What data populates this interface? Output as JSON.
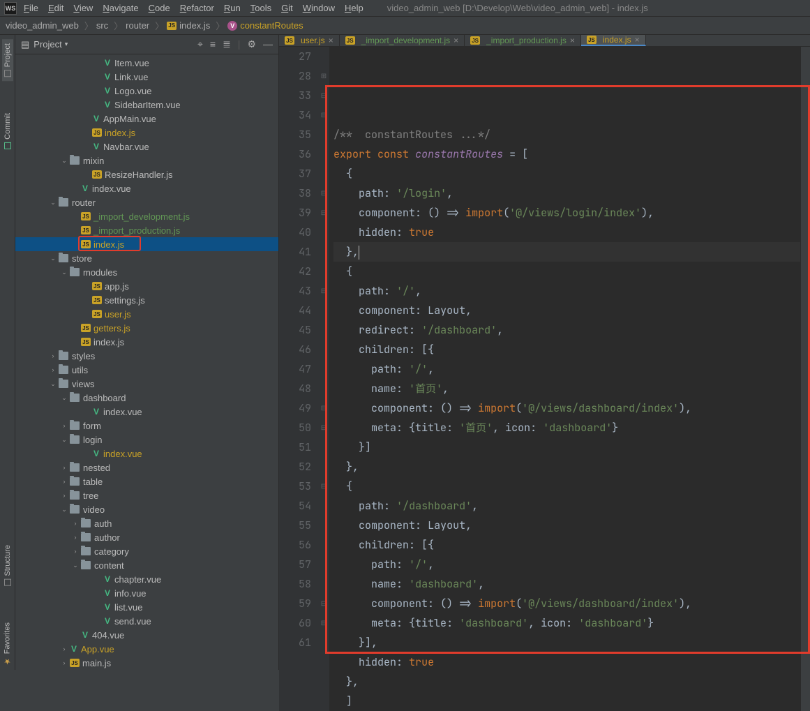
{
  "window_title": "video_admin_web [D:\\Develop\\Web\\video_admin_web] - index.js",
  "menus": [
    "File",
    "Edit",
    "View",
    "Navigate",
    "Code",
    "Refactor",
    "Run",
    "Tools",
    "Git",
    "Window",
    "Help"
  ],
  "breadcrumbs": [
    {
      "label": "video_admin_web",
      "type": "root"
    },
    {
      "label": "src",
      "type": "folder"
    },
    {
      "label": "router",
      "type": "folder"
    },
    {
      "label": "index.js",
      "type": "js"
    },
    {
      "label": "constantRoutes",
      "type": "var"
    }
  ],
  "project_panel_title": "Project",
  "side_tabs": [
    "Project",
    "Commit",
    "Structure",
    "Favorites"
  ],
  "tree": [
    {
      "indent": 7,
      "icon": "vue",
      "label": "Item.vue",
      "cls": ""
    },
    {
      "indent": 7,
      "icon": "vue",
      "label": "Link.vue",
      "cls": ""
    },
    {
      "indent": 7,
      "icon": "vue",
      "label": "Logo.vue",
      "cls": ""
    },
    {
      "indent": 7,
      "icon": "vue",
      "label": "SidebarItem.vue",
      "cls": ""
    },
    {
      "indent": 6,
      "icon": "vue",
      "label": "AppMain.vue",
      "cls": ""
    },
    {
      "indent": 6,
      "icon": "js",
      "label": "index.js",
      "cls": "yellow"
    },
    {
      "indent": 6,
      "icon": "vue",
      "label": "Navbar.vue",
      "cls": ""
    },
    {
      "indent": 4,
      "exp": "v",
      "icon": "folder",
      "label": "mixin",
      "cls": ""
    },
    {
      "indent": 6,
      "icon": "js",
      "label": "ResizeHandler.js",
      "cls": ""
    },
    {
      "indent": 5,
      "icon": "vue",
      "label": "index.vue",
      "cls": ""
    },
    {
      "indent": 3,
      "exp": "v",
      "icon": "folder",
      "label": "router",
      "cls": ""
    },
    {
      "indent": 5,
      "icon": "js",
      "label": "_import_development.js",
      "cls": "green"
    },
    {
      "indent": 5,
      "icon": "js",
      "label": "_import_production.js",
      "cls": "green"
    },
    {
      "indent": 5,
      "icon": "js",
      "label": "index.js",
      "cls": "yellow",
      "sel": true
    },
    {
      "indent": 3,
      "exp": "v",
      "icon": "folder",
      "label": "store",
      "cls": ""
    },
    {
      "indent": 4,
      "exp": "v",
      "icon": "folder",
      "label": "modules",
      "cls": ""
    },
    {
      "indent": 6,
      "icon": "js",
      "label": "app.js",
      "cls": ""
    },
    {
      "indent": 6,
      "icon": "js",
      "label": "settings.js",
      "cls": ""
    },
    {
      "indent": 6,
      "icon": "js",
      "label": "user.js",
      "cls": "yellow"
    },
    {
      "indent": 5,
      "icon": "js",
      "label": "getters.js",
      "cls": "yellow"
    },
    {
      "indent": 5,
      "icon": "js",
      "label": "index.js",
      "cls": ""
    },
    {
      "indent": 3,
      "exp": ">",
      "icon": "folder",
      "label": "styles",
      "cls": ""
    },
    {
      "indent": 3,
      "exp": ">",
      "icon": "folder",
      "label": "utils",
      "cls": ""
    },
    {
      "indent": 3,
      "exp": "v",
      "icon": "folder",
      "label": "views",
      "cls": ""
    },
    {
      "indent": 4,
      "exp": "v",
      "icon": "folder",
      "label": "dashboard",
      "cls": ""
    },
    {
      "indent": 6,
      "icon": "vue",
      "label": "index.vue",
      "cls": ""
    },
    {
      "indent": 4,
      "exp": ">",
      "icon": "folder",
      "label": "form",
      "cls": ""
    },
    {
      "indent": 4,
      "exp": "v",
      "icon": "folder",
      "label": "login",
      "cls": ""
    },
    {
      "indent": 6,
      "icon": "vue",
      "label": "index.vue",
      "cls": "yellow"
    },
    {
      "indent": 4,
      "exp": ">",
      "icon": "folder",
      "label": "nested",
      "cls": ""
    },
    {
      "indent": 4,
      "exp": ">",
      "icon": "folder",
      "label": "table",
      "cls": ""
    },
    {
      "indent": 4,
      "exp": ">",
      "icon": "folder",
      "label": "tree",
      "cls": ""
    },
    {
      "indent": 4,
      "exp": "v",
      "icon": "folder",
      "label": "video",
      "cls": ""
    },
    {
      "indent": 5,
      "exp": ">",
      "icon": "folder",
      "label": "auth",
      "cls": ""
    },
    {
      "indent": 5,
      "exp": ">",
      "icon": "folder",
      "label": "author",
      "cls": ""
    },
    {
      "indent": 5,
      "exp": ">",
      "icon": "folder",
      "label": "category",
      "cls": ""
    },
    {
      "indent": 5,
      "exp": "v",
      "icon": "folder",
      "label": "content",
      "cls": ""
    },
    {
      "indent": 7,
      "icon": "vue",
      "label": "chapter.vue",
      "cls": ""
    },
    {
      "indent": 7,
      "icon": "vue",
      "label": "info.vue",
      "cls": ""
    },
    {
      "indent": 7,
      "icon": "vue",
      "label": "list.vue",
      "cls": ""
    },
    {
      "indent": 7,
      "icon": "vue",
      "label": "send.vue",
      "cls": ""
    },
    {
      "indent": 5,
      "icon": "vue",
      "label": "404.vue",
      "cls": ""
    },
    {
      "indent": 4,
      "exp": ">",
      "icon": "vue",
      "label": "App.vue",
      "cls": "yellow"
    },
    {
      "indent": 4,
      "exp": ">",
      "icon": "js",
      "label": "main.js",
      "cls": ""
    }
  ],
  "editor_tabs": [
    {
      "label": "user.js",
      "cls": "yellow",
      "active": false
    },
    {
      "label": "_import_development.js",
      "cls": "green",
      "active": false
    },
    {
      "label": "_import_production.js",
      "cls": "green",
      "active": false
    },
    {
      "label": "index.js",
      "cls": "yellow",
      "active": true
    }
  ],
  "line_numbers": [
    "27",
    "28",
    "33",
    "34",
    "35",
    "36",
    "37",
    "38",
    "39",
    "40",
    "41",
    "42",
    "43",
    "44",
    "45",
    "46",
    "47",
    "48",
    "49",
    "50",
    "51",
    "52",
    "53",
    "54",
    "55",
    "56",
    "57",
    "58",
    "59",
    "60",
    "61"
  ],
  "code_lines": [
    {
      "html": ""
    },
    {
      "html": "<span class='cmt'>/**  constantRoutes ...*/</span>"
    },
    {
      "html": "<span class='kw'>export</span> <span class='kw'>const</span> <span class='fn'>constantRoutes</span> <span class='punct'>= [</span>"
    },
    {
      "html": "  <span class='punct'>{</span>"
    },
    {
      "html": "    <span class='id'>path</span><span class='punct'>:</span> <span class='str'>'/login'</span><span class='punct'>,</span>"
    },
    {
      "html": "    <span class='id'>component</span><span class='punct'>: () =&gt;</span> <span class='imp'>import</span><span class='punct'>(</span><span class='str'>'@/views/login/index'</span><span class='punct'>),</span>"
    },
    {
      "html": "    <span class='id'>hidden</span><span class='punct'>:</span> <span class='kw'>true</span>"
    },
    {
      "html": "  <span class='punct'>},</span><span class='caret'></span>",
      "cursor": true
    },
    {
      "html": "  <span class='punct'>{</span>"
    },
    {
      "html": "    <span class='id'>path</span><span class='punct'>:</span> <span class='str'>'/'</span><span class='punct'>,</span>"
    },
    {
      "html": "    <span class='id'>component</span><span class='punct'>:</span> <span class='id'>Layout</span><span class='punct'>,</span>"
    },
    {
      "html": "    <span class='id'>redirect</span><span class='punct'>:</span> <span class='str'>'/dashboard'</span><span class='punct'>,</span>"
    },
    {
      "html": "    <span class='id'>children</span><span class='punct'>: [{</span>"
    },
    {
      "html": "      <span class='id'>path</span><span class='punct'>:</span> <span class='str'>'/'</span><span class='punct'>,</span>"
    },
    {
      "html": "      <span class='id'>name</span><span class='punct'>:</span> <span class='str'>'首页'</span><span class='punct'>,</span>"
    },
    {
      "html": "      <span class='id'>component</span><span class='punct'>: () =&gt;</span> <span class='imp'>import</span><span class='punct'>(</span><span class='str'>'@/views/dashboard/index'</span><span class='punct'>),</span>"
    },
    {
      "html": "      <span class='id'>meta</span><span class='punct'>: {</span><span class='id'>title</span><span class='punct'>:</span> <span class='str'>'首页'</span><span class='punct'>,</span> <span class='id'>icon</span><span class='punct'>:</span> <span class='str'>'dashboard'</span><span class='punct'>}</span>"
    },
    {
      "html": "    <span class='punct'>}]</span>"
    },
    {
      "html": "  <span class='punct'>},</span>"
    },
    {
      "html": "  <span class='punct'>{</span>"
    },
    {
      "html": "    <span class='id'>path</span><span class='punct'>:</span> <span class='str'>'/dashboard'</span><span class='punct'>,</span>"
    },
    {
      "html": "    <span class='id'>component</span><span class='punct'>:</span> <span class='id'>Layout</span><span class='punct'>,</span>"
    },
    {
      "html": "    <span class='id'>children</span><span class='punct'>: [{</span>"
    },
    {
      "html": "      <span class='id'>path</span><span class='punct'>:</span> <span class='str'>'/'</span><span class='punct'>,</span>"
    },
    {
      "html": "      <span class='id'>name</span><span class='punct'>:</span> <span class='str'>'dashboard'</span><span class='punct'>,</span>"
    },
    {
      "html": "      <span class='id'>component</span><span class='punct'>: () =&gt;</span> <span class='imp'>import</span><span class='punct'>(</span><span class='str'>'@/views/dashboard/index'</span><span class='punct'>),</span>"
    },
    {
      "html": "      <span class='id'>meta</span><span class='punct'>: {</span><span class='id'>title</span><span class='punct'>:</span> <span class='str'>'dashboard'</span><span class='punct'>,</span> <span class='id'>icon</span><span class='punct'>:</span> <span class='str'>'dashboard'</span><span class='punct'>}</span>"
    },
    {
      "html": "    <span class='punct'>}],</span>"
    },
    {
      "html": "    <span class='id'>hidden</span><span class='punct'>:</span> <span class='kw'>true</span>"
    },
    {
      "html": "  <span class='punct'>},</span>"
    },
    {
      "html": "<span class='punct'>  ]</span>"
    }
  ]
}
